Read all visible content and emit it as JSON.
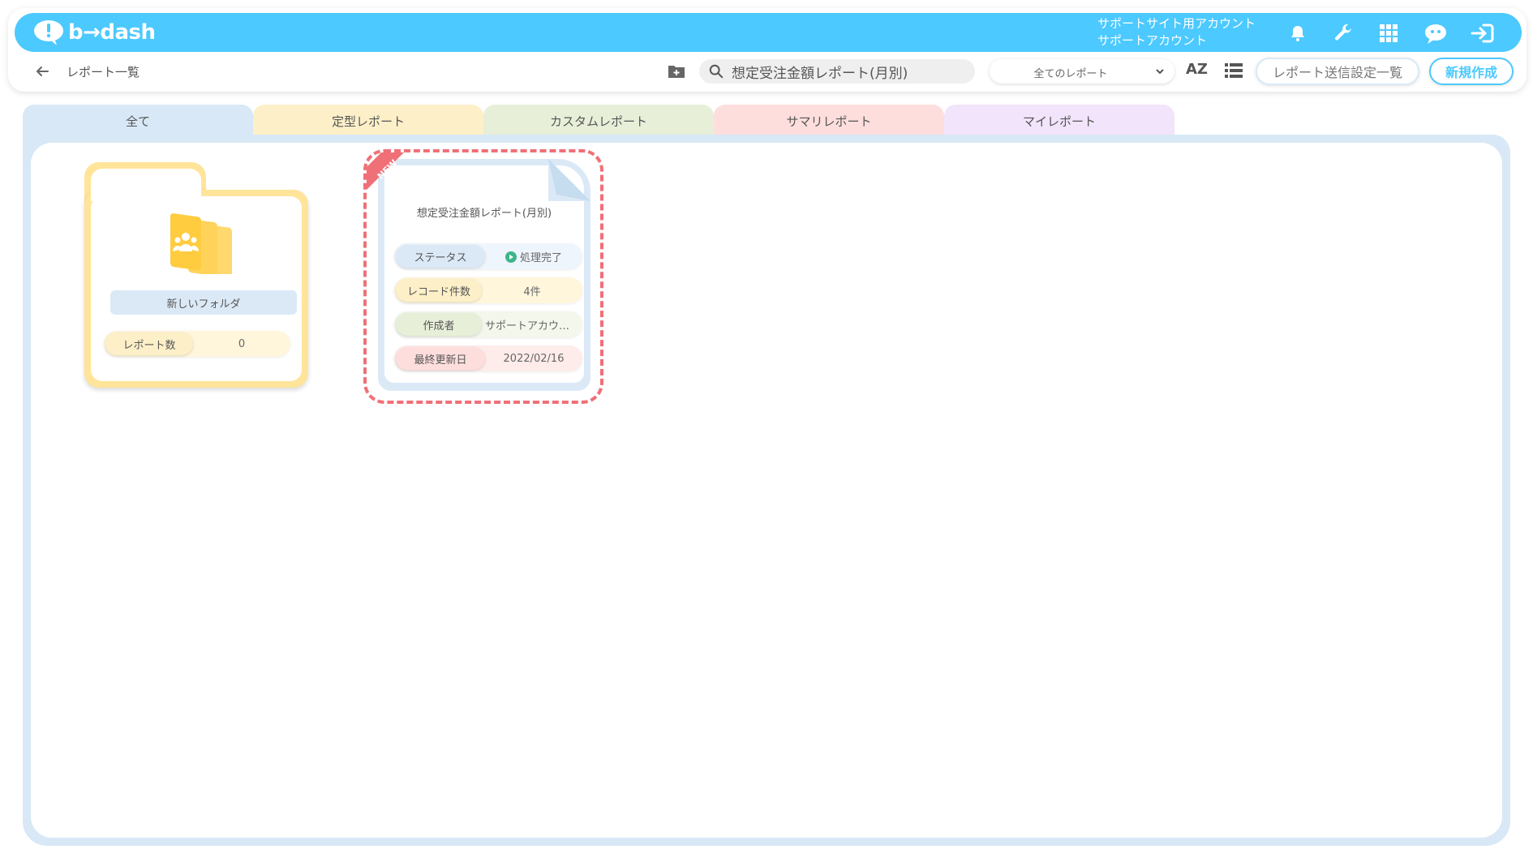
{
  "brand": {
    "logo_text": "b→dash"
  },
  "account": {
    "line1": "サポートサイト用アカウント",
    "line2": "サポートアカウント"
  },
  "topbar_icons": [
    "bell-icon",
    "wrench-icon",
    "grid-icon",
    "chatbot-icon",
    "logout-icon"
  ],
  "breadcrumb": {
    "title": "レポート一覧"
  },
  "search": {
    "value": "想定受注金額レポート(月別)"
  },
  "filter": {
    "selected": "全てのレポート"
  },
  "sort": {
    "label": "AZ"
  },
  "buttons": {
    "send_settings": "レポート送信設定一覧",
    "new": "新規作成"
  },
  "tabs": [
    {
      "label": "全て",
      "color": "#d8e8f6"
    },
    {
      "label": "定型レポート",
      "color": "#fdf0c8"
    },
    {
      "label": "カスタムレポート",
      "color": "#e8efd8"
    },
    {
      "label": "サマリレポート",
      "color": "#fddedd"
    },
    {
      "label": "マイレポート",
      "color": "#f1e4fb"
    }
  ],
  "folder": {
    "name": "新しいフォルダ",
    "count_label": "レポート数",
    "count_value": "0"
  },
  "report": {
    "badge": "NEW",
    "title": "想定受注金額レポート(月別)",
    "rows": [
      {
        "label": "ステータス",
        "value": "処理完了",
        "color": "#dbe9f7"
      },
      {
        "label": "レコード件数",
        "value": "4件",
        "color": "#fdf0c8"
      },
      {
        "label": "作成者",
        "value": "サポートアカウン...",
        "color": "#e8efd8"
      },
      {
        "label": "最終更新日",
        "value": "2022/02/16",
        "color": "#fddedd"
      }
    ]
  }
}
